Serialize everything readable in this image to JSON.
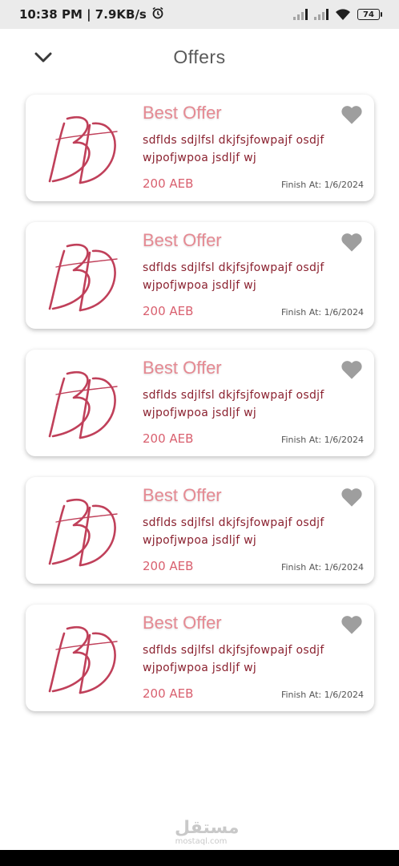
{
  "status_bar": {
    "time_speed": "10:38 PM | 7.9KB/s",
    "alarm_icon": "alarm-clock-icon",
    "battery": "74"
  },
  "header": {
    "title": "Offers",
    "back_icon": "chevron-down-icon"
  },
  "offers": [
    {
      "title": "Best Offer",
      "description": "sdflds sdjlfsl dkjfsjfowpajf osdjf wjpofjwpoa jsdljf wj",
      "price": "200 AEB",
      "finish": "Finish At: 1/6/2024",
      "logo": "BD"
    },
    {
      "title": "Best Offer",
      "description": "sdflds sdjlfsl dkjfsjfowpajf osdjf wjpofjwpoa jsdljf wj",
      "price": "200 AEB",
      "finish": "Finish At: 1/6/2024",
      "logo": "BD"
    },
    {
      "title": "Best Offer",
      "description": "sdflds sdjlfsl dkjfsjfowpajf osdjf wjpofjwpoa jsdljf wj",
      "price": "200 AEB",
      "finish": "Finish At: 1/6/2024",
      "logo": "BD"
    },
    {
      "title": "Best Offer",
      "description": "sdflds sdjlfsl dkjfsjfowpajf osdjf wjpofjwpoa jsdljf wj",
      "price": "200 AEB",
      "finish": "Finish At: 1/6/2024",
      "logo": "BD"
    },
    {
      "title": "Best Offer",
      "description": "sdflds sdjlfsl dkjfsjfowpajf osdjf wjpofjwpoa jsdljf wj",
      "price": "200 AEB",
      "finish": "Finish At: 1/6/2024",
      "logo": "BD"
    }
  ],
  "watermark": {
    "arabic": "مستقل",
    "latin": "mostaql.com"
  },
  "colors": {
    "accent_title": "#e58a93",
    "description": "#8b2230",
    "price": "#d9606f",
    "logo": "#c0405a",
    "favorite_icon": "#9e9e9e"
  }
}
